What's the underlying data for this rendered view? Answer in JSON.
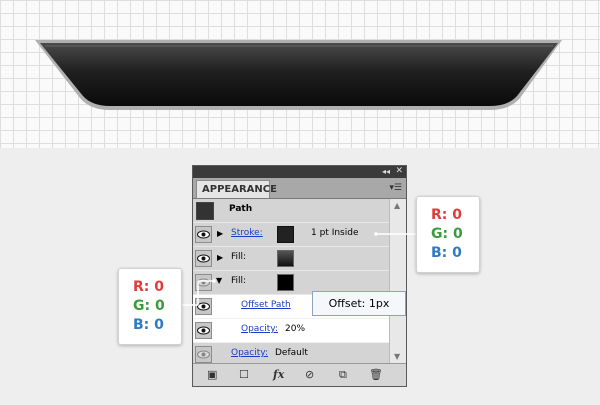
{
  "panel": {
    "title_tab": "APPEARANCE",
    "path_row": {
      "label": "Path"
    },
    "rows": [
      {
        "name": "stroke",
        "label": "Stroke:",
        "value": "1 pt  Inside"
      },
      {
        "name": "fill-1",
        "label": "Fill:"
      },
      {
        "name": "fill-2",
        "label": "Fill:"
      },
      {
        "name": "offset-path",
        "label": "Offset Path"
      },
      {
        "name": "opacity-inner",
        "label": "Opacity:",
        "value": "20%"
      },
      {
        "name": "opacity-outer",
        "label": "Opacity:",
        "value": "Default"
      }
    ],
    "toolbar": {
      "fx_label": "fx"
    }
  },
  "tooltip": {
    "text": "Offset: 1px"
  },
  "stroke_color": {
    "r_label": "R: 0",
    "g_label": "G: 0",
    "b_label": "B: 0"
  },
  "fill_color": {
    "r_label": "R: 0",
    "g_label": "G: 0",
    "b_label": "B: 0"
  },
  "colors": {
    "red": "#e03a3a",
    "green": "#3a9b3a",
    "blue": "#2f7ac2",
    "link": "#1a3ec8"
  },
  "icons": [
    "collapse-icon",
    "close-icon",
    "panel-menu-icon",
    "eye-icon",
    "expand-triangle-icon",
    "new-art-icon",
    "clear-appearance-icon",
    "fx-icon",
    "no-icon",
    "duplicate-icon",
    "trash-icon"
  ]
}
